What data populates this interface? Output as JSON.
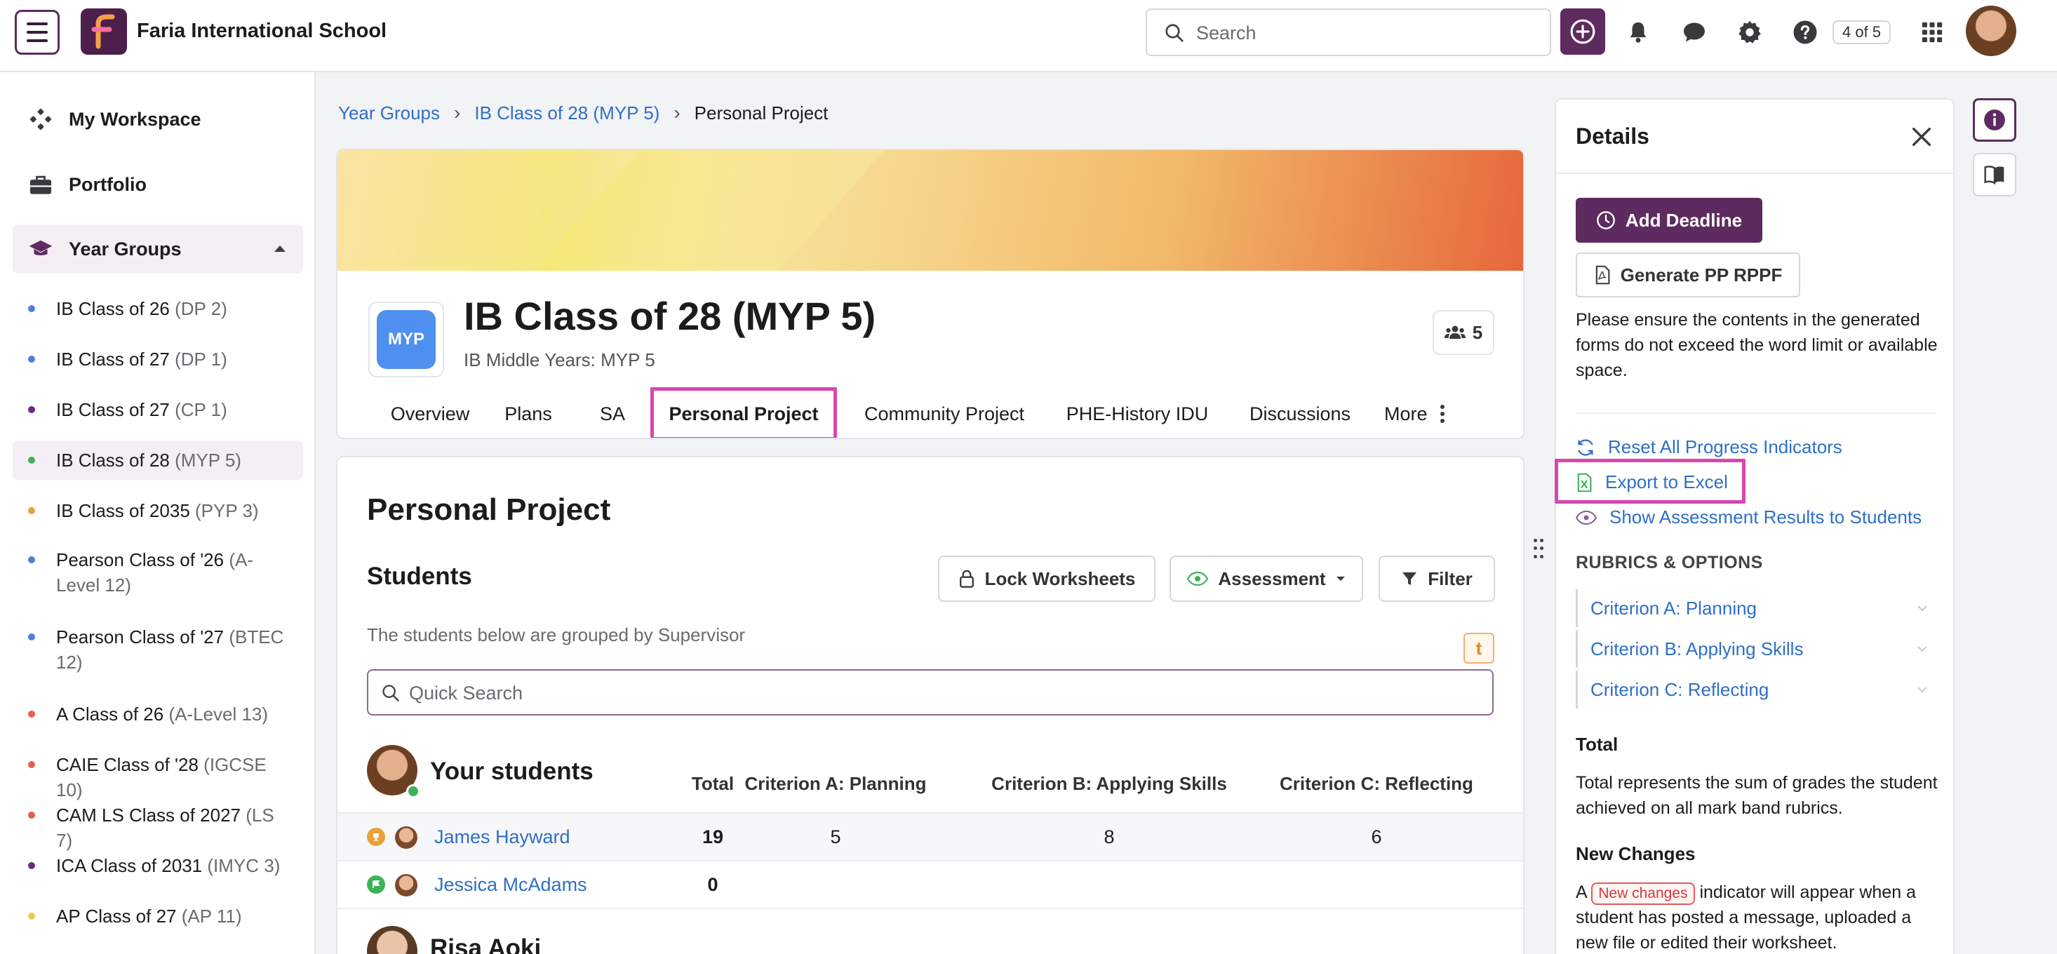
{
  "topbar": {
    "school_name": "Faria International School",
    "search_placeholder": "Search",
    "page_counter": "4 of 5"
  },
  "sidebar": {
    "workspace": "My Workspace",
    "portfolio": "Portfolio",
    "year_groups": "Year Groups",
    "items": [
      {
        "name": "IB Class of 26",
        "suffix": "(DP 2)",
        "color": "#4a7fe0"
      },
      {
        "name": "IB Class of 27",
        "suffix": "(DP 1)",
        "color": "#4a7fe0"
      },
      {
        "name": "IB Class of 27",
        "suffix": "(CP 1)",
        "color": "#6b2a8a"
      },
      {
        "name": "IB Class of 28",
        "suffix": "(MYP 5)",
        "color": "#3cb35a"
      },
      {
        "name": "IB Class of 2035",
        "suffix": "(PYP 3)",
        "color": "#e8a23a"
      },
      {
        "name": "Pearson Class of '26",
        "suffix": "(A-Level 12)",
        "color": "#4a7fe0"
      },
      {
        "name": "Pearson Class of '27",
        "suffix": "(BTEC 12)",
        "color": "#4a7fe0"
      },
      {
        "name": "A Class of 26",
        "suffix": "(A-Level 13)",
        "color": "#e5604a"
      },
      {
        "name": "CAIE Class of '28",
        "suffix": "(IGCSE 10)",
        "color": "#e5604a"
      },
      {
        "name": "CAM LS Class of 2027",
        "suffix": "(LS 7)",
        "color": "#e5604a"
      },
      {
        "name": "ICA Class of 2031",
        "suffix": "(IMYC 3)",
        "color": "#6b2a8a"
      },
      {
        "name": "AP Class of 27",
        "suffix": "(AP 11)",
        "color": "#f0c64a"
      }
    ]
  },
  "breadcrumb": {
    "items": [
      "Year Groups",
      "IB Class of 28 (MYP 5)"
    ],
    "current": "Personal Project"
  },
  "hero": {
    "badge": "MYP",
    "title": "IB Class of 28 (MYP 5)",
    "subtitle": "IB Middle Years: MYP 5",
    "member_count": "5",
    "tabs": [
      "Overview",
      "Plans",
      "SA",
      "Personal Project",
      "Community Project",
      "PHE-History IDU",
      "Discussions",
      "More"
    ],
    "active_tab": "Personal Project"
  },
  "content": {
    "title": "Personal Project",
    "students_heading": "Students",
    "lock_worksheets": "Lock Worksheets",
    "assessment": "Assessment",
    "filter": "Filter",
    "grouped_note": "The students below are grouped by Supervisor",
    "t_badge": "t",
    "quick_search_placeholder": "Quick Search",
    "group_title": "Your students",
    "columns": [
      "Total",
      "Criterion A: Planning",
      "Criterion B: Applying Skills",
      "Criterion C: Reflecting"
    ],
    "rows": [
      {
        "name": "James Hayward",
        "total": "19",
        "a": "5",
        "b": "8",
        "c": "6",
        "status_color": "#e8a23a"
      },
      {
        "name": "Jessica McAdams",
        "total": "0",
        "a": "",
        "b": "",
        "c": "",
        "status_color": "#3cb35a"
      }
    ],
    "next_group": "Risa Aoki"
  },
  "details": {
    "title": "Details",
    "add_deadline": "Add Deadline",
    "generate": "Generate PP RPPF",
    "ensure_text": "Please ensure the contents in the generated forms do not exceed the word limit or available space.",
    "reset": "Reset All Progress Indicators",
    "export": "Export to Excel",
    "show_results": "Show Assessment Results to Students",
    "rubrics_title": "RUBRICS & OPTIONS",
    "criteria": [
      "Criterion A: Planning",
      "Criterion B: Applying Skills",
      "Criterion C: Reflecting"
    ],
    "total_heading": "Total",
    "total_text": "Total represents the sum of grades the student achieved on all mark band rubrics.",
    "new_changes_heading": "New Changes",
    "nc_prefix": "A",
    "nc_badge": "New changes",
    "nc_suffix": "indicator will appear when a student has posted a message, uploaded a new file or edited their worksheet."
  }
}
